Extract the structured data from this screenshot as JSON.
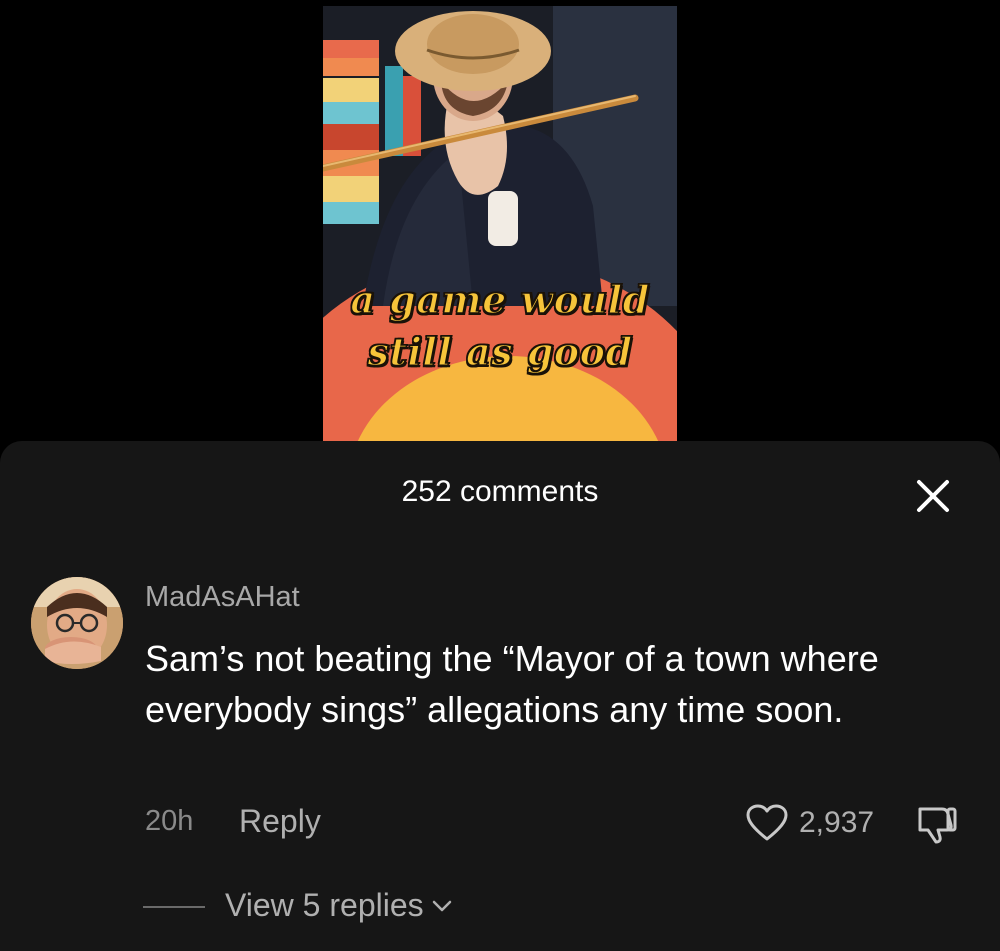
{
  "video": {
    "caption_line1": "a game would",
    "caption_line2": "still as good"
  },
  "comments_sheet": {
    "title": "252 comments",
    "close_icon": "close-icon"
  },
  "comment": {
    "username": "MadAsAHat",
    "text": "Sam’s not beating the “Mayor of a town where everybody sings” allegations any time soon.",
    "timestamp": "20h",
    "reply_label": "Reply",
    "like_count": "2,937",
    "like_icon": "heart-icon",
    "dislike_icon": "thumbs-down-icon",
    "view_replies_label": "View 5 replies",
    "view_replies_icon": "chevron-down-icon"
  },
  "colors": {
    "sheet_background": "#161616",
    "secondary_text": "#a8a8a8",
    "caption_yellow": "#f6c43a"
  }
}
